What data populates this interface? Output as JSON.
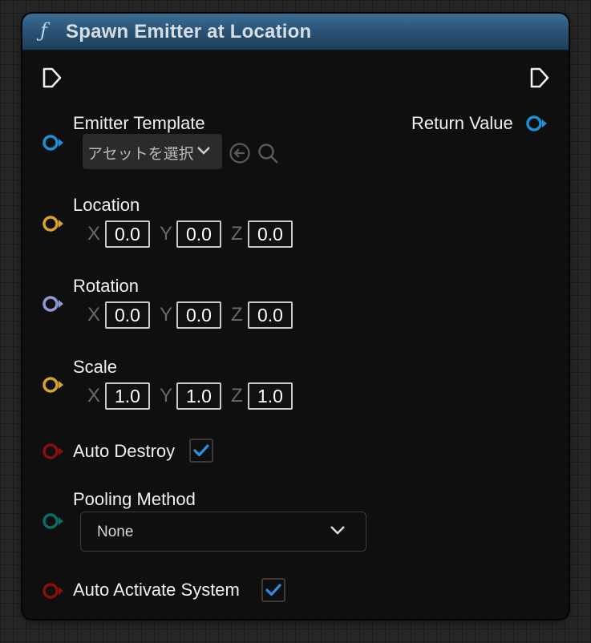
{
  "node": {
    "title": "Spawn Emitter at Location",
    "function_icon": "ƒ",
    "header_color": "#2a5577"
  },
  "pins": {
    "emitter_template": {
      "label": "Emitter Template",
      "asset_placeholder": "アセットを選択",
      "color": "#1e8fd6"
    },
    "return_value": {
      "label": "Return Value",
      "color": "#1e8fd6"
    },
    "location": {
      "label": "Location",
      "color": "#d7a42a",
      "x_label": "X",
      "x": "0.0",
      "y_label": "Y",
      "y": "0.0",
      "z_label": "Z",
      "z": "0.0"
    },
    "rotation": {
      "label": "Rotation",
      "color": "#8f98d8",
      "x_label": "X",
      "x": "0.0",
      "y_label": "Y",
      "y": "0.0",
      "z_label": "Z",
      "z": "0.0"
    },
    "scale": {
      "label": "Scale",
      "color": "#d7a42a",
      "x_label": "X",
      "x": "1.0",
      "y_label": "Y",
      "y": "1.0",
      "z_label": "Z",
      "z": "1.0"
    },
    "auto_destroy": {
      "label": "Auto Destroy",
      "checked": true,
      "color": "#8a0e0e"
    },
    "pooling_method": {
      "label": "Pooling Method",
      "value": "None",
      "color": "#0f6b66"
    },
    "auto_activate_system": {
      "label": "Auto Activate System",
      "checked": true,
      "color": "#8a0e0e"
    }
  },
  "icons": {
    "exec_in": "exec-pin-icon",
    "exec_out": "exec-pin-icon",
    "use_selected_asset": "arrow-left-circle-icon",
    "browse_asset": "search-icon",
    "dropdown": "chevron-down-icon",
    "checkbox_check": "checkmark-icon"
  },
  "colors": {
    "checkmark": "#2f8fe6"
  }
}
